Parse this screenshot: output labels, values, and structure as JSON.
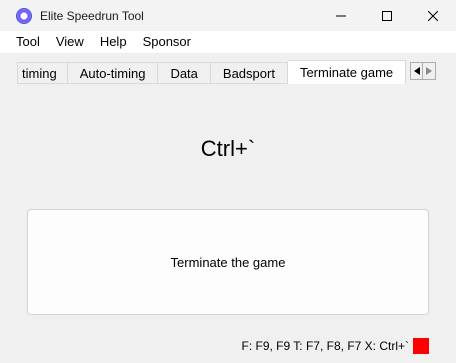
{
  "window": {
    "title": "Elite Speedrun Tool"
  },
  "menu": {
    "items": [
      "Tool",
      "View",
      "Help",
      "Sponsor"
    ]
  },
  "tabs": {
    "items": [
      "timing",
      "Auto-timing",
      "Data",
      "Badsport",
      "Terminate game"
    ],
    "active": "Terminate game"
  },
  "main": {
    "hotkey": "Ctrl+`",
    "action_label": "Terminate the game"
  },
  "status": {
    "text": "F: F9, F9  T: F7, F8, F7  X: Ctrl+`",
    "indicator_color": "#ff0000"
  }
}
